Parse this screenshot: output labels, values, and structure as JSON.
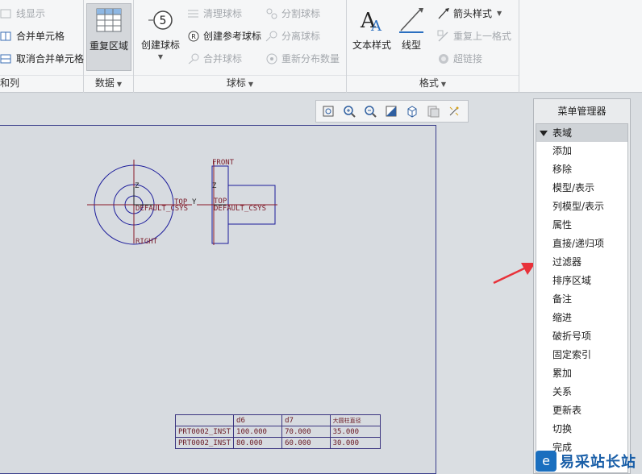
{
  "ribbon": {
    "group1": {
      "items": [
        "线显示",
        "合并单元格",
        "取消合并单元格"
      ],
      "label": "和列"
    },
    "group_data": {
      "repeat_region": "重复区域",
      "label": "数据"
    },
    "group_balloon": {
      "create_balloon": "创建球标",
      "clean_balloons": "清理球标",
      "create_ref_balloon": "创建参考球标",
      "merge_balloons": "合并球标",
      "split_balloons": "分割球标",
      "detach_balloons": "分离球标",
      "redistribute_qty": "重新分布数量",
      "label": "球标"
    },
    "group_format": {
      "text_style": "文本样式",
      "line_style": "线型",
      "arrow_style": "箭头样式",
      "repeat_last_format": "重复上一格式",
      "hyperlink": "超链接",
      "label": "格式"
    }
  },
  "drawing": {
    "front_label": "FRONT",
    "top_label": "TOP",
    "right_label": "RIGHT",
    "csys_left": "DEFAULT_CSYS",
    "csys_right": "DEFAULT_CSYS",
    "top_right": "TOP",
    "z_left": "Z",
    "z_right": "Z",
    "y_left": "Y"
  },
  "table": {
    "header": [
      "",
      "d6",
      "d7",
      "大圆柱直径"
    ],
    "rows": [
      [
        "PRT0002_INST",
        "100.000",
        "70.000",
        "35.000"
      ],
      [
        "PRT0002_INST",
        "80.000",
        "60.000",
        "30.000"
      ]
    ]
  },
  "menu_manager": {
    "title": "菜单管理器",
    "section": "表域",
    "items": [
      "添加",
      "移除",
      "模型/表示",
      "列模型/表示",
      "属性",
      "直接/递归项",
      "过滤器",
      "排序区域",
      "备注",
      "缩进",
      "破折号项",
      "固定索引",
      "累加",
      "关系",
      "更新表",
      "切换",
      "完成"
    ]
  },
  "watermark": {
    "text": "易采站长站",
    "logo_glyph": "e"
  },
  "colors": {
    "sheet_border": "#3b3f8c",
    "drawing_line": "#1b1b9a",
    "arrow": "#e8323a",
    "table_text": "#6a1a24"
  }
}
